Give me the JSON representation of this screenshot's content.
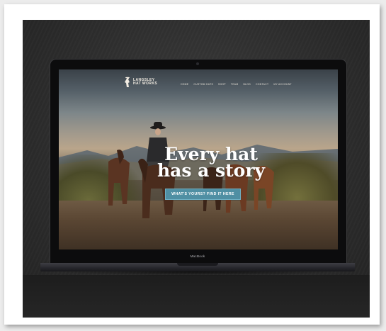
{
  "website": {
    "logo": {
      "line1": "LANGSLEY",
      "line2": "HAT WORKS"
    },
    "nav_items": [
      "HOME",
      "CUSTOM HATS",
      "SHOP",
      "TEAM",
      "BLOG",
      "CONTACT",
      "MY ACCOUNT"
    ],
    "headline_line1": "Every hat",
    "headline_line2": "has a story",
    "cta_label": "WHAT'S YOURS? FIND IT HERE"
  },
  "laptop": {
    "brand_label": "MacBook"
  },
  "colors": {
    "cta": "#4f8fa3",
    "background_wall": "#2e2e2e",
    "frame": "#ffffff"
  }
}
